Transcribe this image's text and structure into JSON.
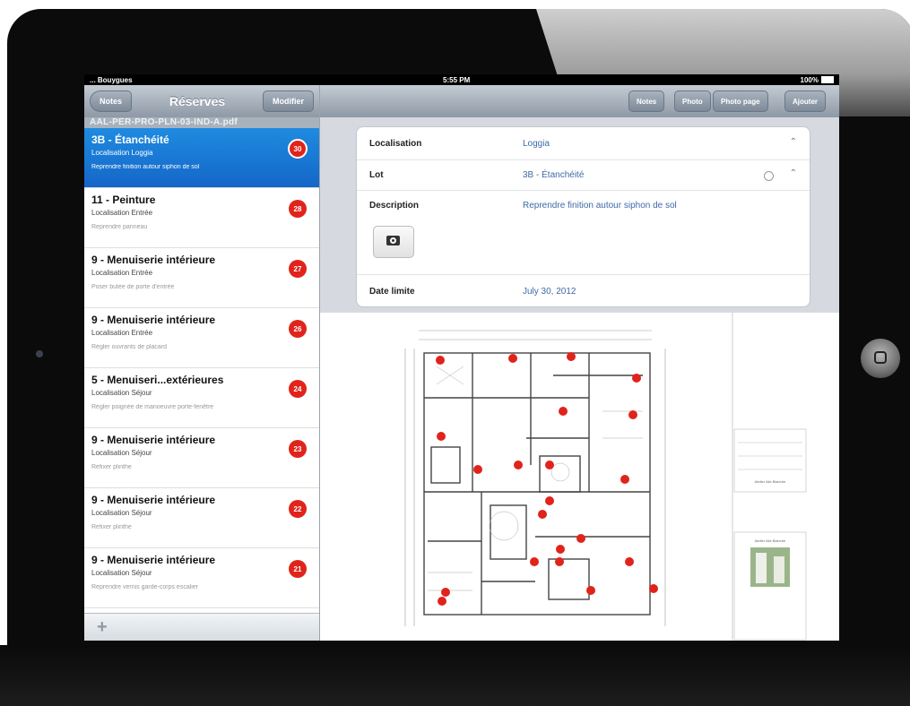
{
  "status": {
    "carrier": "... Bouygues",
    "time": "5:55 PM",
    "battery": "100%"
  },
  "left": {
    "back_label": "Notes",
    "title": "Réserves",
    "modify_label": "Modifier",
    "document": "AAL-PER-PRO-PLN-03-IND-A.pdf",
    "items": [
      {
        "title": "3B - Étanchéité",
        "location": "Localisation Loggia",
        "description": "Reprendre finition autour siphon de sol",
        "badge": "30",
        "selected": true
      },
      {
        "title": "11 - Peinture",
        "location": "Localisation Entrée",
        "description": "Reprendre panneau",
        "badge": "28"
      },
      {
        "title": "9 - Menuiserie intérieure",
        "location": "Localisation Entrée",
        "description": "Poser butée de porte d'entrée",
        "badge": "27"
      },
      {
        "title": "9 - Menuiserie intérieure",
        "location": "Localisation Entrée",
        "description": "Régler ouvrants de placard",
        "badge": "26"
      },
      {
        "title": "5 - Menuiseri...extérieures",
        "location": "Localisation Séjour",
        "description": "Régler poignée de manoeuvre porte-fenêtre",
        "badge": "24"
      },
      {
        "title": "9 - Menuiserie intérieure",
        "location": "Localisation Séjour",
        "description": "Refixer plinthe",
        "badge": "23"
      },
      {
        "title": "9 - Menuiserie intérieure",
        "location": "Localisation Séjour",
        "description": "Refixer plinthe",
        "badge": "22"
      },
      {
        "title": "9 - Menuiserie intérieure",
        "location": "Localisation Séjour",
        "description": "Reprendre vernis garde-corps escalier",
        "badge": "21"
      }
    ],
    "add_icon": "plus-icon"
  },
  "toolbar": {
    "notes": "Notes",
    "photo": "Photo",
    "photo_page": "Photo page",
    "add": "Ajouter"
  },
  "detail": {
    "localisation_label": "Localisation",
    "localisation_value": "Loggia",
    "lot_label": "Lot",
    "lot_value": "3B - Étanchéité",
    "description_label": "Description",
    "description_value": "Reprendre finition autour siphon de sol",
    "date_label": "Date limite",
    "date_value": "July 30, 2012"
  },
  "plan": {
    "title_block_1": "Atelier Aile Blanche",
    "title_block_2": "Atelier Aile Blanche"
  },
  "colors": {
    "badge": "#e0241b",
    "selection": "#1a77d6",
    "link": "#3f6aa6"
  }
}
